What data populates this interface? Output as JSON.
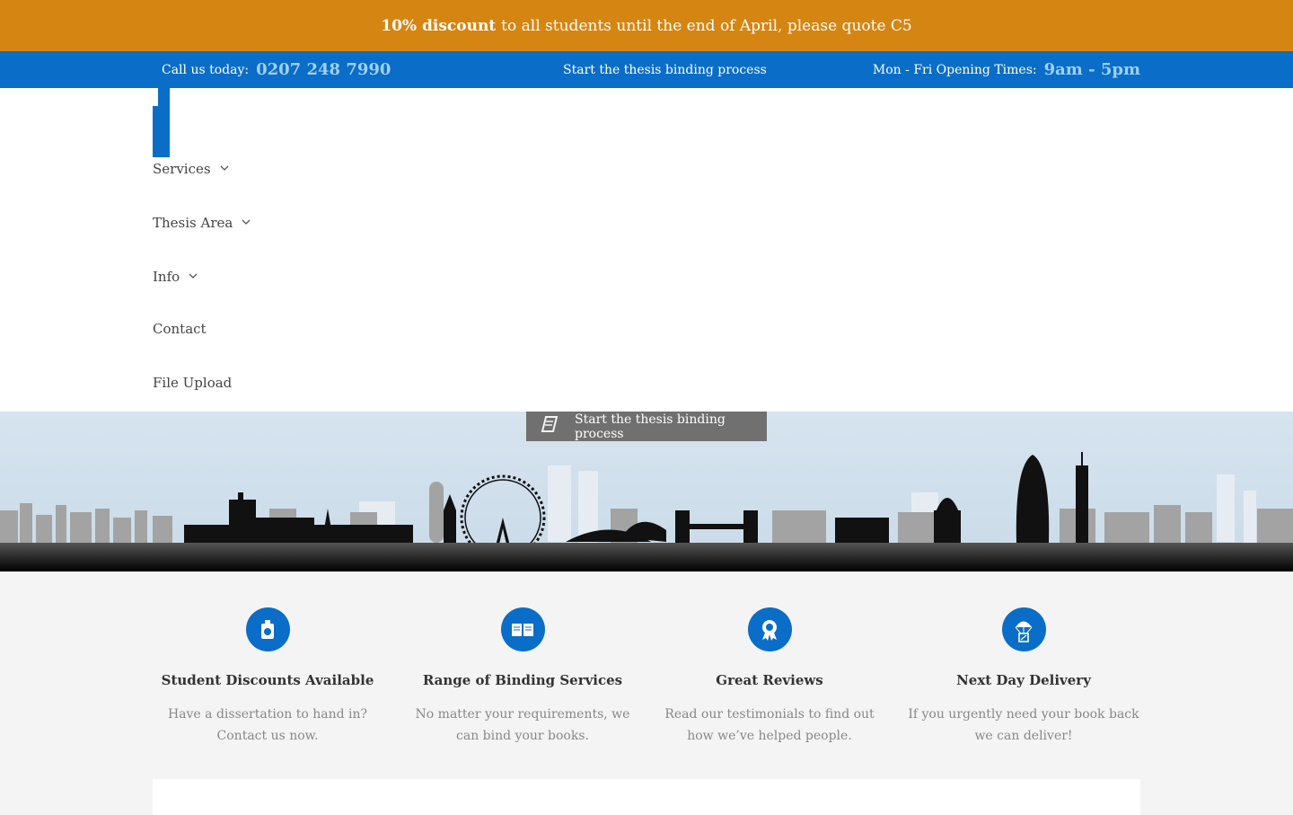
{
  "promo": {
    "bold": "10% discount",
    "rest": "to all students until the end of April, please quote C5"
  },
  "topbar": {
    "call_label": "Call us today:",
    "phone": "0207 248 7990",
    "center_link": "Start the thesis binding process",
    "hours_label": "Mon - Fri Opening Times:",
    "hours": "9am - 5pm"
  },
  "nav": {
    "items": [
      {
        "label": "Services",
        "has_dropdown": true
      },
      {
        "label": "Thesis Area",
        "has_dropdown": true
      },
      {
        "label": "Info",
        "has_dropdown": true
      },
      {
        "label": "Contact",
        "has_dropdown": false
      },
      {
        "label": "File Upload",
        "has_dropdown": false
      }
    ]
  },
  "hero": {
    "cta_label": "Start the thesis binding process",
    "cta_icon": "book-icon"
  },
  "features": [
    {
      "icon": "discount-tag-icon",
      "title": "Student Discounts Available",
      "text": "Have a dissertation to hand in? Contact us now."
    },
    {
      "icon": "open-book-icon",
      "title": "Range of Binding Services",
      "text": "No matter your requirements, we can bind your books."
    },
    {
      "icon": "award-ribbon-icon",
      "title": "Great Reviews",
      "text": "Read our testimonials to find out how we’ve helped people."
    },
    {
      "icon": "parachute-delivery-icon",
      "title": "Next Day Delivery",
      "text": "If you urgently need your book back we can deliver!"
    }
  ],
  "colors": {
    "promo_bg": "#d58512",
    "brand_blue": "#0a6dc7",
    "highlight": "#9fd0f5"
  }
}
